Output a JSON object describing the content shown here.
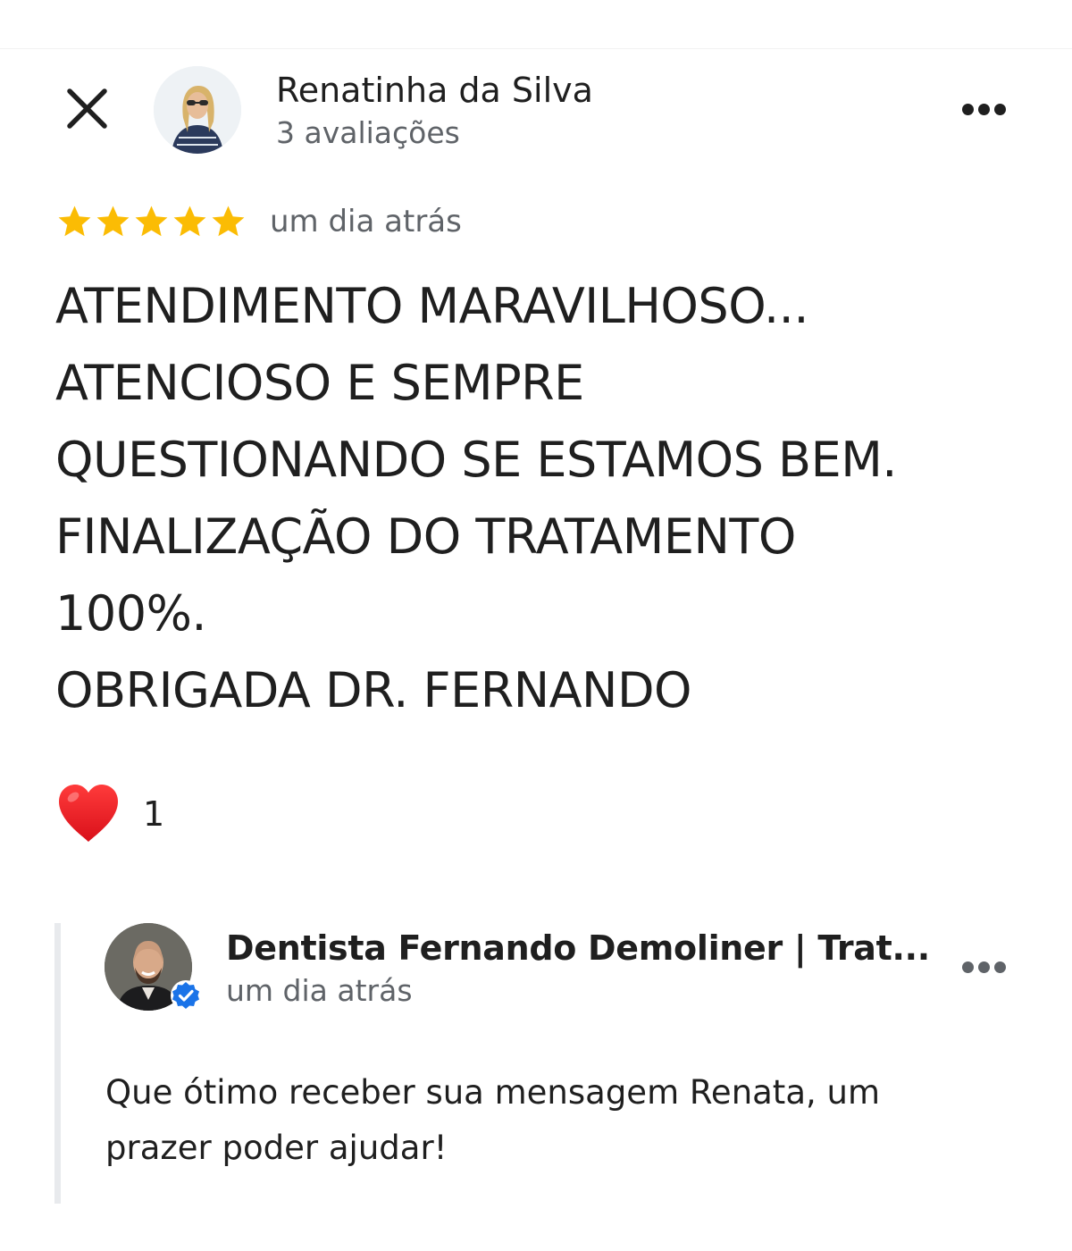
{
  "header": {
    "close_icon": "close-icon",
    "more_icon": "more-horizontal-icon"
  },
  "review": {
    "reviewer_name": "Renatinha da Silva",
    "reviewer_meta": "3 avaliações",
    "rating": 5,
    "rating_max": 5,
    "star_color": "#fbbc04",
    "date": "um dia atrás",
    "text_lines": [
      "ATENDIMENTO MARAVILHOSO...",
      "ATENCIOSO E SEMPRE",
      "QUESTIONANDO SE ESTAMOS BEM.",
      "FINALIZAÇÃO DO TRATAMENTO",
      "100%.",
      "OBRIGADA DR. FERNANDO"
    ],
    "reaction_icon": "red-heart-icon",
    "reaction_count": "1"
  },
  "owner_reply": {
    "name": "Dentista Fernando Demoliner | Trat...",
    "date": "um dia atrás",
    "verified_icon": "verified-badge-icon",
    "verified_color": "#1a73e8",
    "text_lines": [
      "Que ótimo receber sua mensagem Renata, um",
      "prazer poder ajudar!"
    ]
  }
}
